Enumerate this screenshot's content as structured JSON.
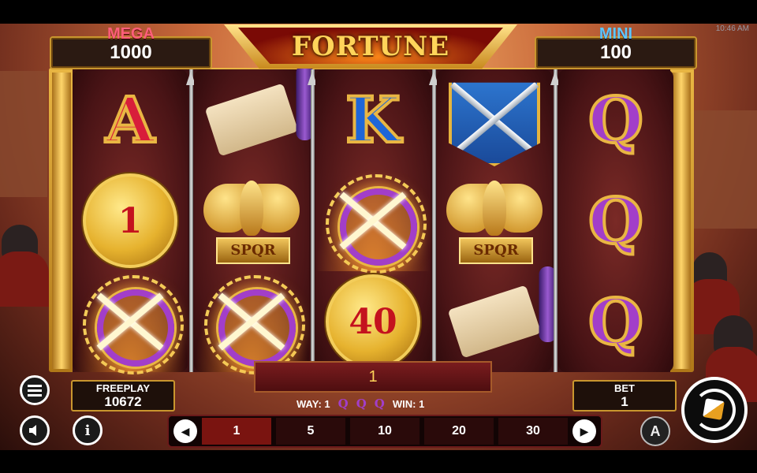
{
  "status_bar": {
    "time": "10:46 AM"
  },
  "jackpots": {
    "mega": {
      "label": "MEGA",
      "value": "1000"
    },
    "mini": {
      "label": "MINI",
      "value": "100"
    }
  },
  "logo": {
    "text": "FORTUNE"
  },
  "reels": [
    [
      "A",
      "coin-1",
      "wild"
    ],
    [
      "scroll",
      "eagle-spqr",
      "wild"
    ],
    [
      "K",
      "wild",
      "coin-40"
    ],
    [
      "shield-swords",
      "eagle-spqr",
      "scroll"
    ],
    [
      "Q",
      "Q",
      "Q"
    ]
  ],
  "symbol_text": {
    "letter_a": "A",
    "letter_k": "K",
    "letter_q": "Q",
    "coin_1": "1",
    "coin_40": "40",
    "spqr": "SPQR"
  },
  "win_display": {
    "value": "1"
  },
  "freeplay": {
    "label": "FREEPLAY",
    "value": "10672"
  },
  "bet": {
    "label": "BET",
    "value": "1"
  },
  "way_line": {
    "way_label": "WAY: 1",
    "symbols": [
      "Q",
      "Q",
      "Q"
    ],
    "win_label": "WIN: 1"
  },
  "bet_options": [
    "1",
    "5",
    "10",
    "20",
    "30"
  ],
  "selected_bet": "1",
  "buttons": {
    "menu": "menu-icon",
    "sound": "speaker-icon",
    "info_glyph": "i",
    "prev_glyph": "◀",
    "next_glyph": "▶",
    "auto_glyph": "A"
  },
  "colors": {
    "gold": "#e9b643",
    "mega": "#ff5f7a",
    "mini": "#5fc8ff",
    "letter_q": "#a23ec9",
    "letter_a": "#d81e3a",
    "letter_k": "#1e66d8",
    "selected_bet_bg": "#7a1410"
  }
}
